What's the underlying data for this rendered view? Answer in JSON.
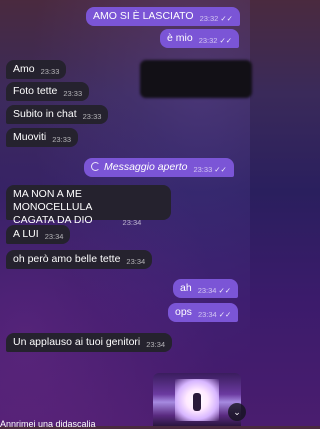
{
  "messages": [
    {
      "text": "AMO SI È LASCIATO",
      "time": "23:32",
      "ticks": "✓✓"
    },
    {
      "text": "è mio",
      "time": "23:32",
      "ticks": "✓✓"
    },
    {
      "text": "Amo",
      "time": "23:33"
    },
    {
      "text": "Foto tette",
      "time": "23:33"
    },
    {
      "text": "Subito in chat",
      "time": "23:33"
    },
    {
      "text": "Muoviti",
      "time": "23:33"
    },
    {
      "text": "Messaggio aperto",
      "time": "23:33",
      "ticks": "✓✓"
    },
    {
      "line1": "MA NON A ME MONOCELLULA",
      "line2": "CAGATA DA DIO",
      "time": "23:34"
    },
    {
      "text": "A LUI",
      "time": "23:34"
    },
    {
      "text": "oh però amo belle tette",
      "time": "23:34"
    },
    {
      "text": "ah",
      "time": "23:34",
      "ticks": "✓✓"
    },
    {
      "text": "ops",
      "time": "23:34",
      "ticks": "✓✓"
    },
    {
      "text": "Un applauso ai tuoi genitori",
      "time": "23:34"
    }
  ],
  "bottom_text": "Annrimei una didascalia",
  "scroll_button": "⌄"
}
